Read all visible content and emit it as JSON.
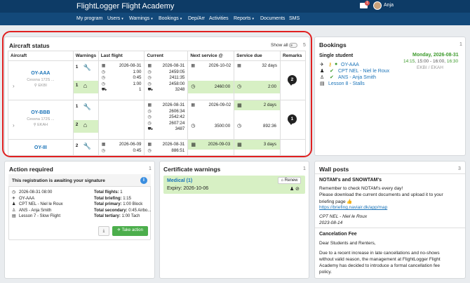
{
  "header": {
    "brand": "FlightLogger Flight Academy",
    "mail_count": "1",
    "username": "Anja"
  },
  "nav": {
    "items": [
      "My program",
      "Users",
      "Warnings",
      "Bookings",
      "Dep/Arr",
      "Activities",
      "Reports",
      "Documents",
      "SMS"
    ],
    "carets": [
      "",
      "▾",
      "▾",
      "▾",
      "",
      "",
      "▾",
      "",
      ""
    ]
  },
  "aircraft_status": {
    "title": "Aircraft status",
    "show_all": "Show all",
    "count": "5",
    "columns": [
      "Aircraft",
      "Warnings",
      "Last flight",
      "Current",
      "Next service @",
      "Service due",
      "Remarks"
    ],
    "rows": [
      {
        "reg": "OY-AAA",
        "model": "Cessna 172S ...",
        "base": "EKBI",
        "w1": "1",
        "w2": "1",
        "last_date": "2026-08-31",
        "last_vals": [
          "1:00",
          "0:45",
          "1:00",
          "1"
        ],
        "current": [
          "2026-08-31",
          "2459:05",
          "2411:35",
          "2458:00",
          "3248"
        ],
        "next_date": "2026-10-02",
        "next_val": "2460:00",
        "due_days": "32 days",
        "due_val": "2:00",
        "remarks": "2"
      },
      {
        "reg": "OY-BBB",
        "model": "Cessna 172S ...",
        "base": "EKAH",
        "w1": "1",
        "w2": "2",
        "last_date": "",
        "last_vals": [],
        "current": [
          "2026-08-31",
          "2606:34",
          "2542:42",
          "2607:24",
          "3487"
        ],
        "next_date": "2026-09-02",
        "next_val": "3500:00",
        "due_days": "2 days",
        "due_val": "892:36",
        "remarks": "1"
      },
      {
        "reg": "OY-III",
        "model": "",
        "base": "",
        "w1": "2",
        "w2": "",
        "last_date": "2026-06-09",
        "last_vals": [
          "0:45"
        ],
        "current": [
          "2026-08-31",
          "886:51"
        ],
        "next_date": "2026-09-03",
        "next_val": "",
        "due_days": "3 days",
        "due_val": "",
        "remarks": ""
      }
    ]
  },
  "bookings": {
    "title": "Bookings",
    "count": "1",
    "type": "Single student",
    "date": "Monday, 2026-08-31",
    "time_a": "14:15",
    "time_b": "15:00 - 16:00",
    "time_c": "16:30",
    "route": "EKBI / EKAH",
    "aircraft": "OY-AAA",
    "instructor": "CPT NEL - Niel le Roux",
    "student": "ANS - Anja Smith",
    "lesson": "Lesson 8 - Stalls"
  },
  "action_required": {
    "title": "Action required",
    "count": "1",
    "message": "This registration is awaiting your signature",
    "left": [
      "2026-08-31 08:00",
      "OY-AAA",
      "CPT NEL - Niel le Roux",
      "ANS - Anja Smith",
      "Lesson 7 - Slow Flight"
    ],
    "right": [
      [
        "Total flights:",
        "1"
      ],
      [
        "Total briefing:",
        "1:15"
      ],
      [
        "Total primary:",
        "1:00 Block"
      ],
      [
        "Total secondary:",
        "0:45 Airbo..."
      ],
      [
        "Total tertiary:",
        "1:00 Tach"
      ]
    ],
    "take_action": "Take action"
  },
  "certificate_warnings": {
    "title": "Certificate warnings",
    "count": "1",
    "cert": "Medical (1)",
    "renew": "Renew",
    "expiry": "Expiry: 2026-10-06"
  },
  "wall_posts": {
    "title": "Wall posts",
    "count": "3",
    "p1_title": "NOTAM's and SNOWTAM's",
    "p1_l1": "Remember to check NOTAM's every day!",
    "p1_l2": "Please download the current documents and upload it to your",
    "p1_l3": "briefing page 👍",
    "p1_link": "https://briefing.naviair.dk/app/map",
    "p1_author": "CPT NEL - Niel le Roux",
    "p1_date": "2023-08-14",
    "p2_title": "Cancelation Fee",
    "p2_l1": "Dear Students and Renters,",
    "p2_l2": "Due to a recent increase in late cancellations and no-shows",
    "p2_l3": "without valid reason, the management at FlightLogger Flight",
    "p2_l4": "Academy has decided to introduce a formal cancellation fee",
    "p2_l5": "policy."
  }
}
